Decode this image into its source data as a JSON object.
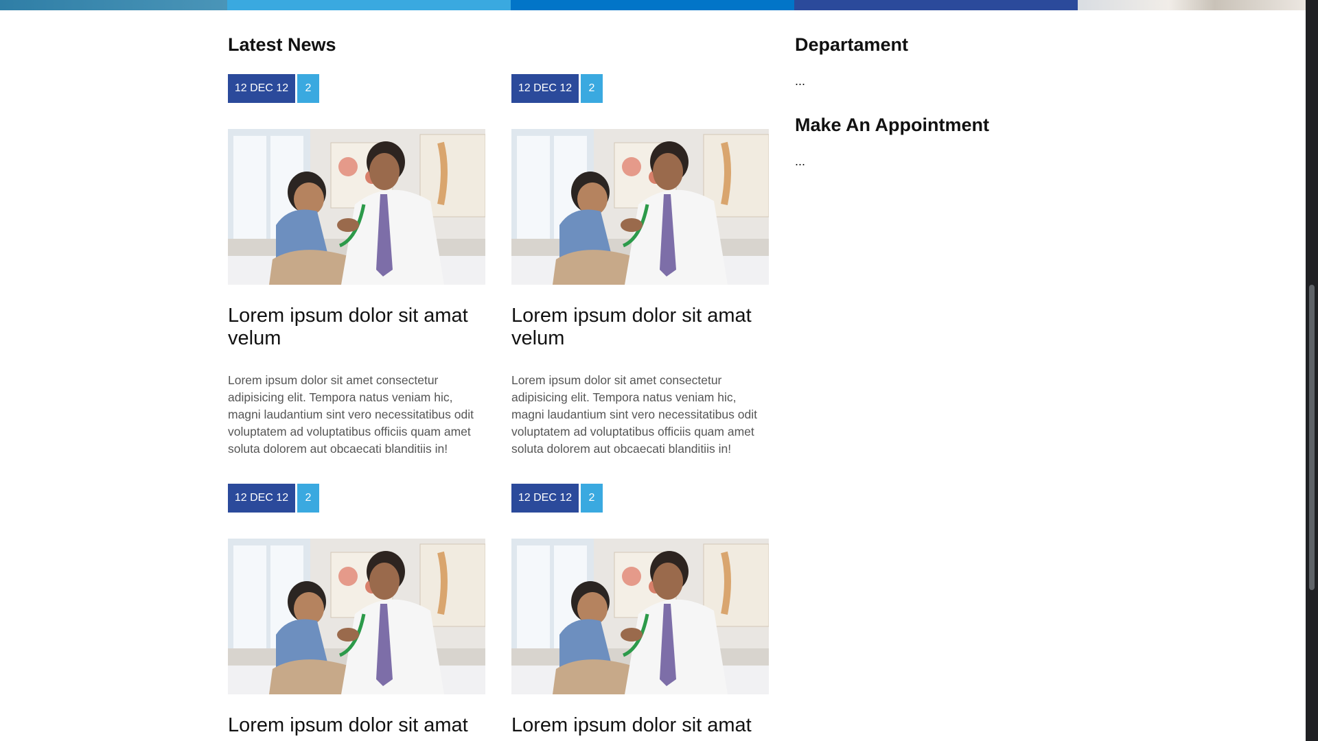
{
  "sections": {
    "latest_news": "Latest News",
    "department": "Departament",
    "department_text": "...",
    "appointment": "Make An Appointment",
    "appointment_text": "..."
  },
  "news": [
    {
      "date": "12 DEC 12",
      "count": "2",
      "title": "Lorem ipsum dolor sit amat velum",
      "text": "Lorem ipsum dolor sit amet consectetur adipisicing elit. Tempora natus veniam hic, magni laudantium sint vero necessitatibus odit voluptatem ad voluptatibus officiis quam amet soluta dolorem aut obcaecati blanditiis in!"
    },
    {
      "date": "12 DEC 12",
      "count": "2",
      "title": "Lorem ipsum dolor sit amat velum",
      "text": "Lorem ipsum dolor sit amet consectetur adipisicing elit. Tempora natus veniam hic, magni laudantium sint vero necessitatibus odit voluptatem ad voluptatibus officiis quam amet soluta dolorem aut obcaecati blanditiis in!"
    },
    {
      "date": "12 DEC 12",
      "count": "2",
      "title": "Lorem ipsum dolor sit amat"
    },
    {
      "date": "12 DEC 12",
      "count": "2",
      "title": "Lorem ipsum dolor sit amat"
    }
  ],
  "colors": {
    "date_badge": "#2b4a9b",
    "count_badge": "#3aa9e0",
    "strip": [
      "#2f7ea6",
      "#3aa9e0",
      "#0275c8",
      "#2b4a9b"
    ]
  },
  "images": {
    "news_photo": "doctor-with-child-photo"
  }
}
